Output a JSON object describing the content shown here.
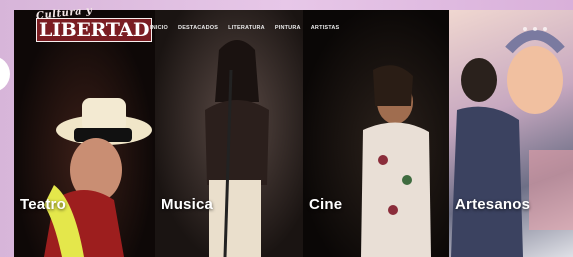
{
  "logo": {
    "line1": "Cultura y",
    "line2": "LIBERTAD"
  },
  "nav": {
    "items": [
      {
        "label": "INICIO"
      },
      {
        "label": "DESTACADOS"
      },
      {
        "label": "LITERATURA"
      },
      {
        "label": "PINTURA"
      },
      {
        "label": "ARTISTAS"
      }
    ]
  },
  "panels": [
    {
      "label": "Teatro"
    },
    {
      "label": "Musica"
    },
    {
      "label": "Cine"
    },
    {
      "label": "Artesanos"
    }
  ]
}
